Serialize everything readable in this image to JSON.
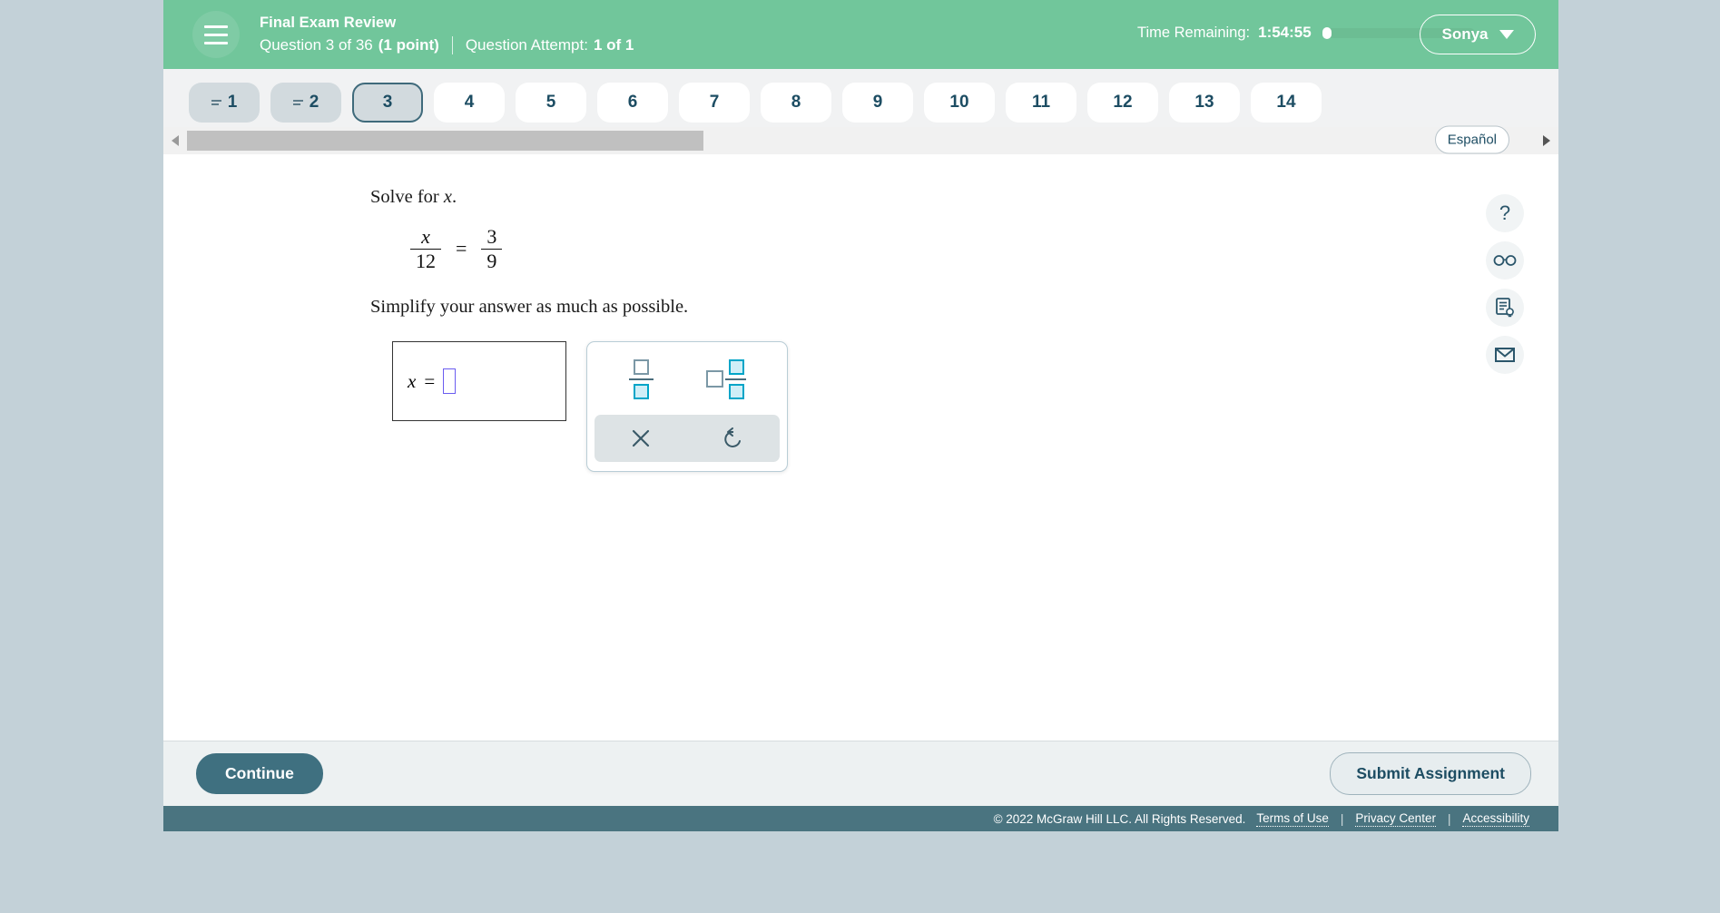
{
  "header": {
    "menu_icon": "hamburger-menu-icon",
    "exam_title": "Final Exam Review",
    "question_label": "Question 3 of 36",
    "points_label": "(1 point)",
    "attempt_label": "Question Attempt:",
    "attempt_value": "1 of 1",
    "time_label": "Time Remaining:",
    "time_value": "1:54:55",
    "time_progress_percent": 5,
    "user_name": "Sonya",
    "user_chevron_icon": "chevron-down-icon",
    "bg_color": "#71c69b"
  },
  "tabs": {
    "items": [
      {
        "label": "1",
        "state": "answered"
      },
      {
        "label": "2",
        "state": "answered"
      },
      {
        "label": "3",
        "state": "current"
      },
      {
        "label": "4",
        "state": "default"
      },
      {
        "label": "5",
        "state": "default"
      },
      {
        "label": "6",
        "state": "default"
      },
      {
        "label": "7",
        "state": "default"
      },
      {
        "label": "8",
        "state": "default"
      },
      {
        "label": "9",
        "state": "default"
      },
      {
        "label": "10",
        "state": "default"
      },
      {
        "label": "11",
        "state": "default"
      },
      {
        "label": "12",
        "state": "default"
      },
      {
        "label": "13",
        "state": "default"
      },
      {
        "label": "14",
        "state": "default"
      }
    ],
    "espanol_label": "Español",
    "next_icon": "chevron-right-icon",
    "scroll_left_icon": "scroll-left-arrow-icon",
    "scroll_right_icon": "scroll-right-arrow-icon"
  },
  "question": {
    "prompt_prefix": "Solve for ",
    "prompt_variable": "x",
    "prompt_suffix": ".",
    "equation": {
      "left_numerator": "x",
      "left_denominator": "12",
      "operator": "=",
      "right_numerator": "3",
      "right_denominator": "9"
    },
    "subprompt": "Simplify your answer as much as possible.",
    "answer": {
      "variable": "x",
      "equals": "=",
      "value": "",
      "placeholder": "empty-answer-slot"
    },
    "keypad": {
      "fraction_icon": "fraction-template-icon",
      "mixed_number_icon": "mixed-number-template-icon",
      "clear_icon": "clear-x-icon",
      "undo_icon": "undo-arrow-icon"
    }
  },
  "toolrail": {
    "items": [
      {
        "icon": "help-question-mark-icon",
        "glyph": "?"
      },
      {
        "icon": "reading-glasses-icon"
      },
      {
        "icon": "explanation-document-icon"
      },
      {
        "icon": "message-envelope-icon"
      }
    ]
  },
  "footer": {
    "continue_label": "Continue",
    "submit_label": "Submit Assignment",
    "copyright": "© 2022 McGraw Hill LLC. All Rights Reserved.",
    "links": [
      "Terms of Use",
      "Privacy Center",
      "Accessibility"
    ],
    "separator": "|"
  },
  "colors": {
    "header_green": "#71c69b",
    "accent_teal": "#3f7080",
    "page_bg": "#c3d1d8",
    "footer_bar": "#4a7480",
    "cyan_keypad": "#00a5c8"
  }
}
